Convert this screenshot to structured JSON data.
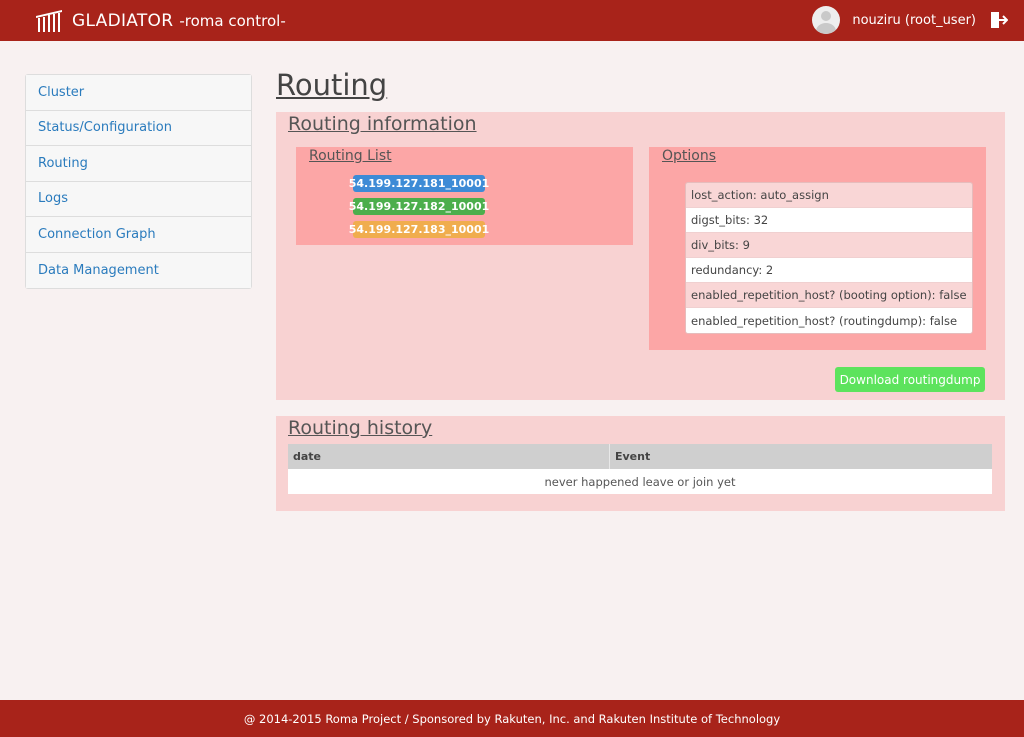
{
  "header": {
    "brand": "GLADIATOR",
    "subtitle": "-roma control-",
    "username": "nouziru (root_user)"
  },
  "sidebar": {
    "items": [
      {
        "label": "Cluster"
      },
      {
        "label": "Status/Configuration"
      },
      {
        "label": "Routing"
      },
      {
        "label": "Logs"
      },
      {
        "label": "Connection Graph"
      },
      {
        "label": "Data Management"
      }
    ]
  },
  "main": {
    "title": "Routing",
    "routing_info": {
      "title": "Routing information",
      "list_title": "Routing List",
      "nodes": [
        {
          "label": "54.199.127.181_10001",
          "color": "#3d8bd6"
        },
        {
          "label": "54.199.127.182_10001",
          "color": "#4cae4c"
        },
        {
          "label": "54.199.127.183_10001",
          "color": "#f0ad4e"
        }
      ],
      "options_title": "Options",
      "options": [
        {
          "text": "lost_action: auto_assign"
        },
        {
          "text": "digst_bits: 32"
        },
        {
          "text": "div_bits: 9"
        },
        {
          "text": "redundancy: 2"
        },
        {
          "text": "enabled_repetition_host? (booting option): false"
        },
        {
          "text": "enabled_repetition_host? (routingdump): false"
        }
      ],
      "download_label": "Download routingdump"
    },
    "routing_history": {
      "title": "Routing history",
      "columns": [
        "date",
        "Event"
      ],
      "empty_text": "never happened leave or join yet"
    }
  },
  "footer": {
    "text": "@ 2014-2015 Roma Project / Sponsored by Rakuten, Inc. and Rakuten Institute of Technology"
  },
  "colors": {
    "header_bg": "#a8231a",
    "panel_bg": "#f8d2d2",
    "box_bg": "#fca6a6",
    "download_button": "#5de35d"
  }
}
